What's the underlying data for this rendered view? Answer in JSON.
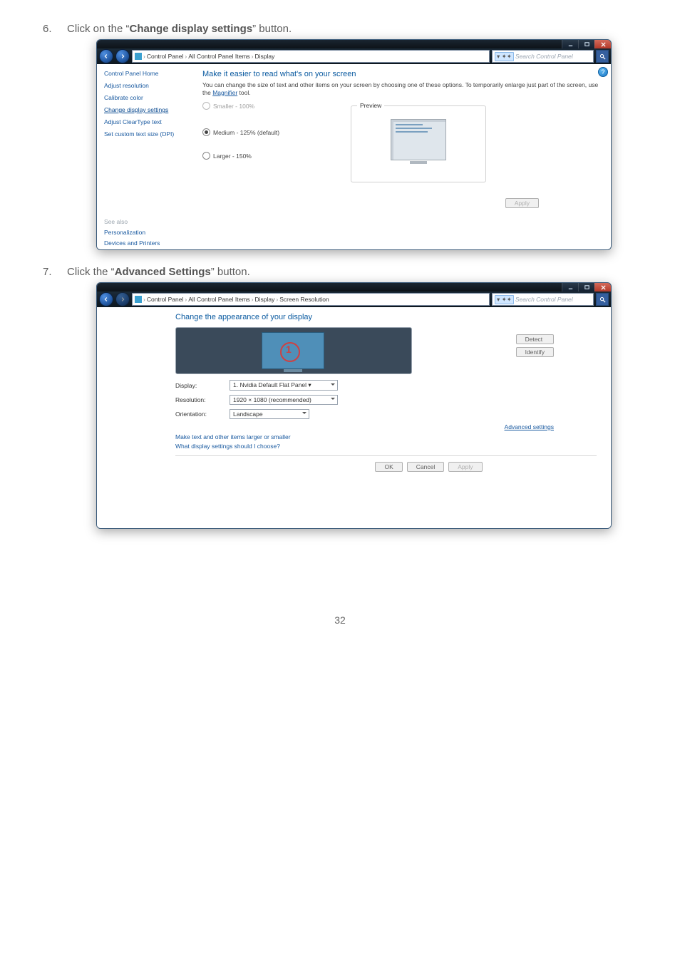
{
  "steps": {
    "s6_num": "6.",
    "s6_a": "Click on the “",
    "s6_b": "Change display settings",
    "s6_c": "” button.",
    "s7_num": "7.",
    "s7_a": "Click the “",
    "s7_b": "Advanced Settings",
    "s7_c": "” button."
  },
  "page_number": "32",
  "common": {
    "search_chip": "▾  ✦✦",
    "search_placeholder": "Search Control Panel"
  },
  "win1": {
    "breadcrumb": {
      "p1": "Control Panel",
      "p2": "All Control Panel Items",
      "p3": "Display"
    },
    "sidebar": {
      "home": "Control Panel Home",
      "adjust_res": "Adjust resolution",
      "calibrate": "Calibrate color",
      "change_disp": "Change display settings",
      "cleartype": "Adjust ClearType text",
      "dpi": "Set custom text size (DPI)",
      "see_also": "See also",
      "personalization": "Personalization",
      "devices": "Devices and Printers"
    },
    "title": "Make it easier to read what's on your screen",
    "desc_a": "You can change the size of text and other items on your screen by choosing one of these options. To temporarily enlarge just part of the screen, use the ",
    "desc_link": "Magnifier",
    "desc_b": " tool.",
    "opt_small": "Smaller - 100%",
    "opt_med": "Medium - 125% (default)",
    "opt_large": "Larger - 150%",
    "preview_legend": "Preview",
    "apply": "Apply",
    "help": "?"
  },
  "win2": {
    "breadcrumb": {
      "p1": "Control Panel",
      "p2": "All Control Panel Items",
      "p3": "Display",
      "p4": "Screen Resolution"
    },
    "title": "Change the appearance of your display",
    "detect": "Detect",
    "identify": "Identify",
    "num": "1",
    "labels": {
      "display": "Display:",
      "resolution": "Resolution:",
      "orientation": "Orientation:"
    },
    "values": {
      "display": "1. Nvidia Default Flat Panel ▾",
      "resolution": "1920 × 1080 (recommended)",
      "orientation": "Landscape"
    },
    "advanced": "Advanced settings",
    "link_larger": "Make text and other items larger or smaller",
    "link_what": "What display settings should I choose?",
    "ok": "OK",
    "cancel": "Cancel",
    "apply": "Apply"
  }
}
